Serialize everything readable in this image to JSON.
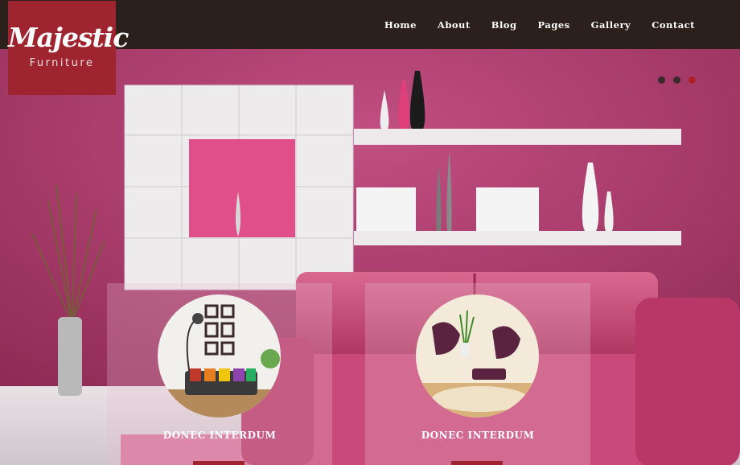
{
  "logo": {
    "line1": "Majestic",
    "line2": "Furniture"
  },
  "nav": [
    "Home",
    "About",
    "Blog",
    "Pages",
    "Gallery",
    "Contact"
  ],
  "slider": {
    "active_index": 2,
    "count": 3
  },
  "cards": [
    {
      "title": "DONEC INTERDUM"
    },
    {
      "title": "DONEC INTERDUM"
    }
  ],
  "colors": {
    "brand": "#9e2430",
    "topbar": "#2b201b",
    "wall": "#b03c6c"
  }
}
